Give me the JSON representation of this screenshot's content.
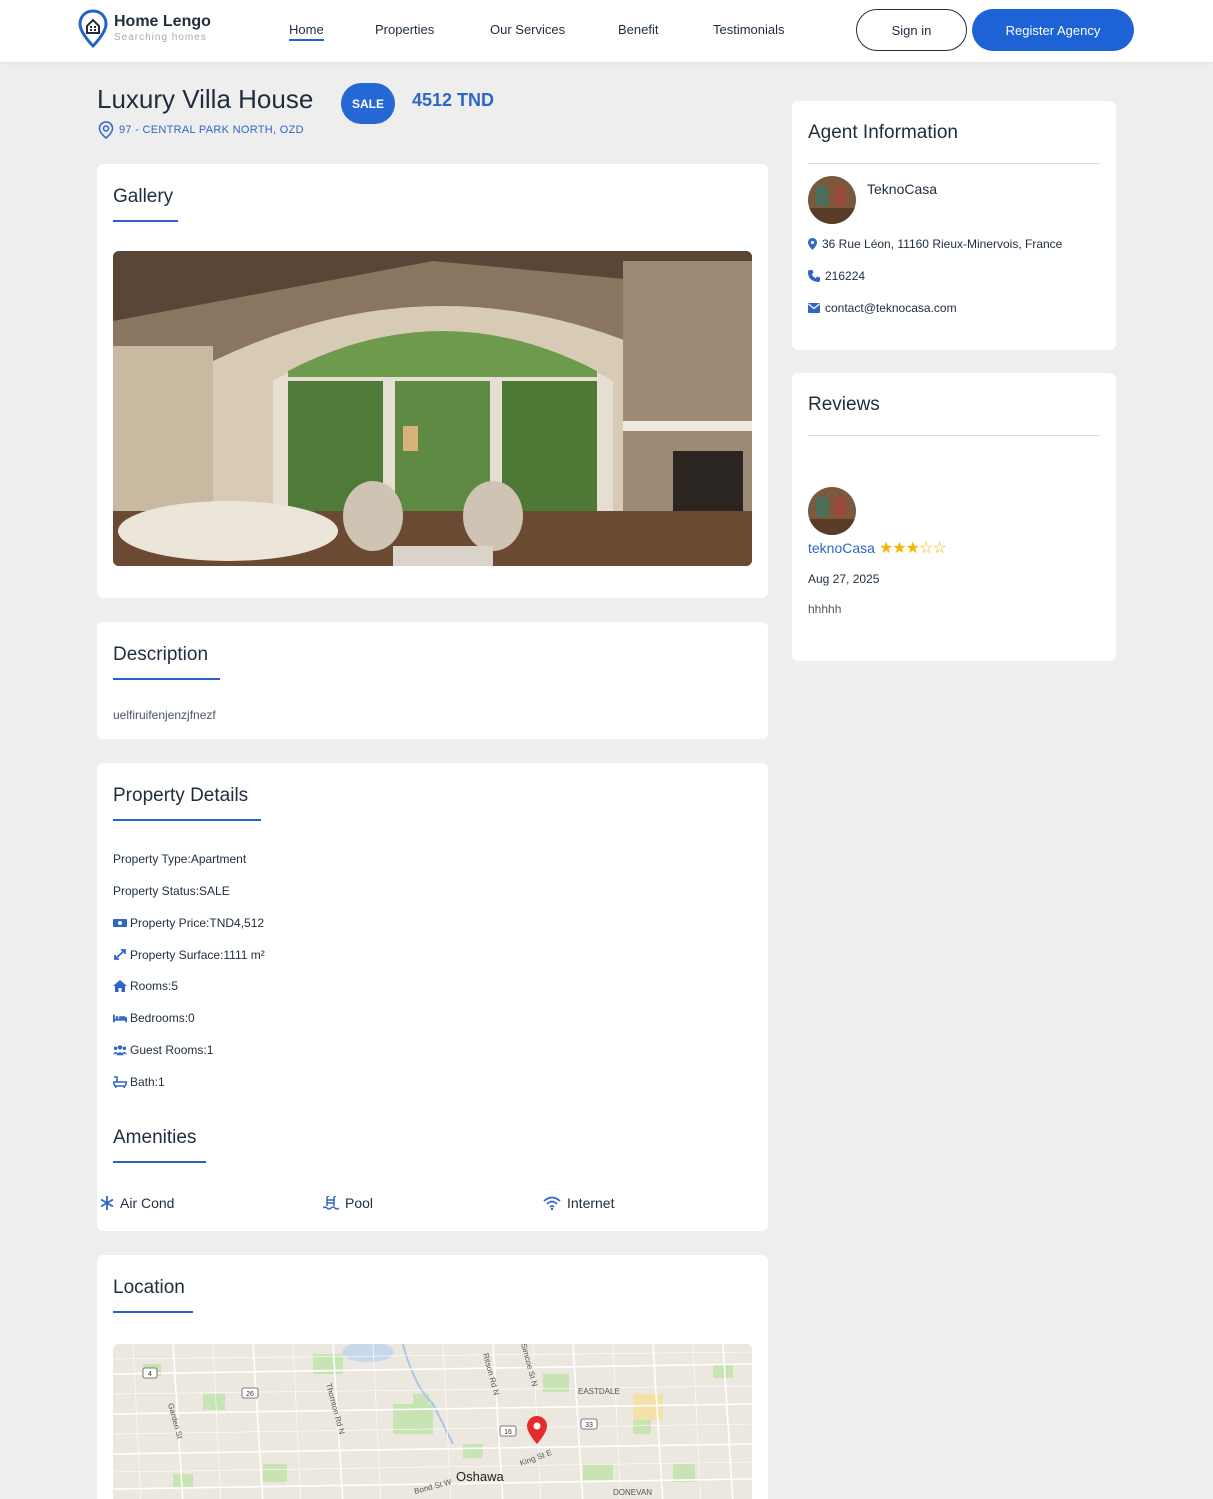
{
  "nav": {
    "brand": "Home Lengo",
    "tagline": "Searching homes",
    "links": [
      "Home",
      "Properties",
      "Our Services",
      "Benefit",
      "Testimonials"
    ],
    "signin": "Sign in",
    "register": "Register Agency"
  },
  "property": {
    "title": "Luxury Villa House",
    "status_badge": "SALE",
    "price": "4512 TND",
    "address": "97 - CENTRAL PARK NORTH, OZD"
  },
  "gallery": {
    "title": "Gallery"
  },
  "description": {
    "title": "Description",
    "text": "uelfiruifenjenzjfnezf"
  },
  "details": {
    "title": "Property Details",
    "rows": [
      {
        "label": "Property Type:",
        "value": " Apartment",
        "icon": ""
      },
      {
        "label": "Property Status:",
        "value": " SALE",
        "icon": ""
      },
      {
        "label": "Property Price:",
        "value": " TND4,512",
        "icon": "money-icon"
      },
      {
        "label": "Property Surface:",
        "value": " 1111 m²",
        "icon": "expand-icon"
      },
      {
        "label": "Rooms:",
        "value": " 5",
        "icon": "home-icon"
      },
      {
        "label": "Bedrooms:",
        "value": " 0",
        "icon": "bed-icon"
      },
      {
        "label": "Guest Rooms:",
        "value": " 1",
        "icon": "users-icon"
      },
      {
        "label": "Bath:",
        "value": " 1",
        "icon": "bath-icon"
      }
    ]
  },
  "amenities": {
    "title": "Amenities",
    "items": [
      {
        "label": "Air Cond",
        "icon": "snowflake-icon"
      },
      {
        "label": "Pool",
        "icon": "pool-icon"
      },
      {
        "label": "Internet",
        "icon": "wifi-icon"
      }
    ]
  },
  "location": {
    "title": "Location",
    "map_labels": [
      "Oshawa",
      "King St E",
      "Bond St W",
      "EASTDALE",
      "DONEVAN",
      "Garden St",
      "Thornton Rd N",
      "Ritson Rd N",
      "Simcoe St N",
      "4",
      "26",
      "16",
      "33"
    ]
  },
  "agent": {
    "title": "Agent Information",
    "name": "TeknoCasa",
    "address": "36 Rue Léon, 11160 Rieux-Minervois, France",
    "phone": "216224",
    "email": "contact@teknocasa.com"
  },
  "reviews": {
    "title": "Reviews",
    "items": [
      {
        "name": "teknoCasa",
        "rating": 3,
        "max": 5,
        "date": "Aug 27, 2025",
        "text": "hhhhh"
      }
    ]
  },
  "colors": {
    "accent": "#1e63d6",
    "link": "#2f66c6",
    "star": "#f5b400",
    "background": "#eeeeee"
  }
}
